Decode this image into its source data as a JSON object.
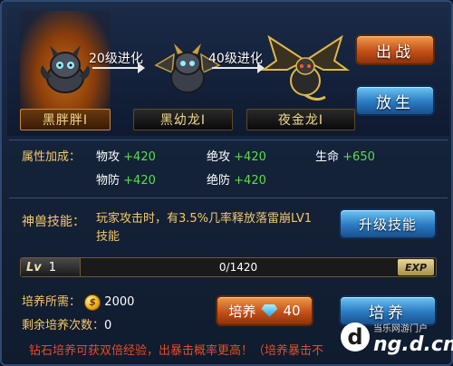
{
  "evolution": {
    "stage1": {
      "name": "黑胖胖Ⅰ",
      "icon": "baby-dragon"
    },
    "step1_label": "20级进化",
    "stage2": {
      "name": "黑幼龙Ⅰ",
      "icon": "young-dragon"
    },
    "step2_label": "40级进化",
    "stage3": {
      "name": "夜金龙Ⅰ",
      "icon": "golden-dragon"
    }
  },
  "buttons": {
    "deploy": "出战",
    "release": "放生",
    "upgrade_skill": "升级技能",
    "train_gem": "培养",
    "train_gem_cost": "40",
    "train": "培养"
  },
  "attributes": {
    "title": "属性加成：",
    "phys_atk_label": "物攻",
    "phys_atk_value": "+420",
    "ult_atk_label": "绝攻",
    "ult_atk_value": "+420",
    "life_label": "生命",
    "life_value": "+650",
    "phys_def_label": "物防",
    "phys_def_value": "+420",
    "ult_def_label": "绝防",
    "ult_def_value": "+420"
  },
  "skill": {
    "title": "神兽技能：",
    "description": "玩家攻击时，有3.5%几率释放落雷崩LV1技能"
  },
  "level": {
    "tag": "Lv",
    "value": "1",
    "xp_text": "0/1420",
    "xp_fraction": 0,
    "exp_tag": "EXP"
  },
  "training": {
    "cost_label": "培养所需：",
    "cost_value": "2000",
    "remaining_label": "剩余培养次数：",
    "remaining_value": "0"
  },
  "footer": {
    "note": "钻石培养可获双倍经验，出暴击概率更高！（培养暴击不"
  },
  "watermark": {
    "line1": "当乐网游门户",
    "line2": "ng.d.cn",
    "logo": "d"
  },
  "colors": {
    "gold_text": "#f3c86a",
    "green_plus": "#5edc4a",
    "warning_red": "#e84a2a"
  }
}
